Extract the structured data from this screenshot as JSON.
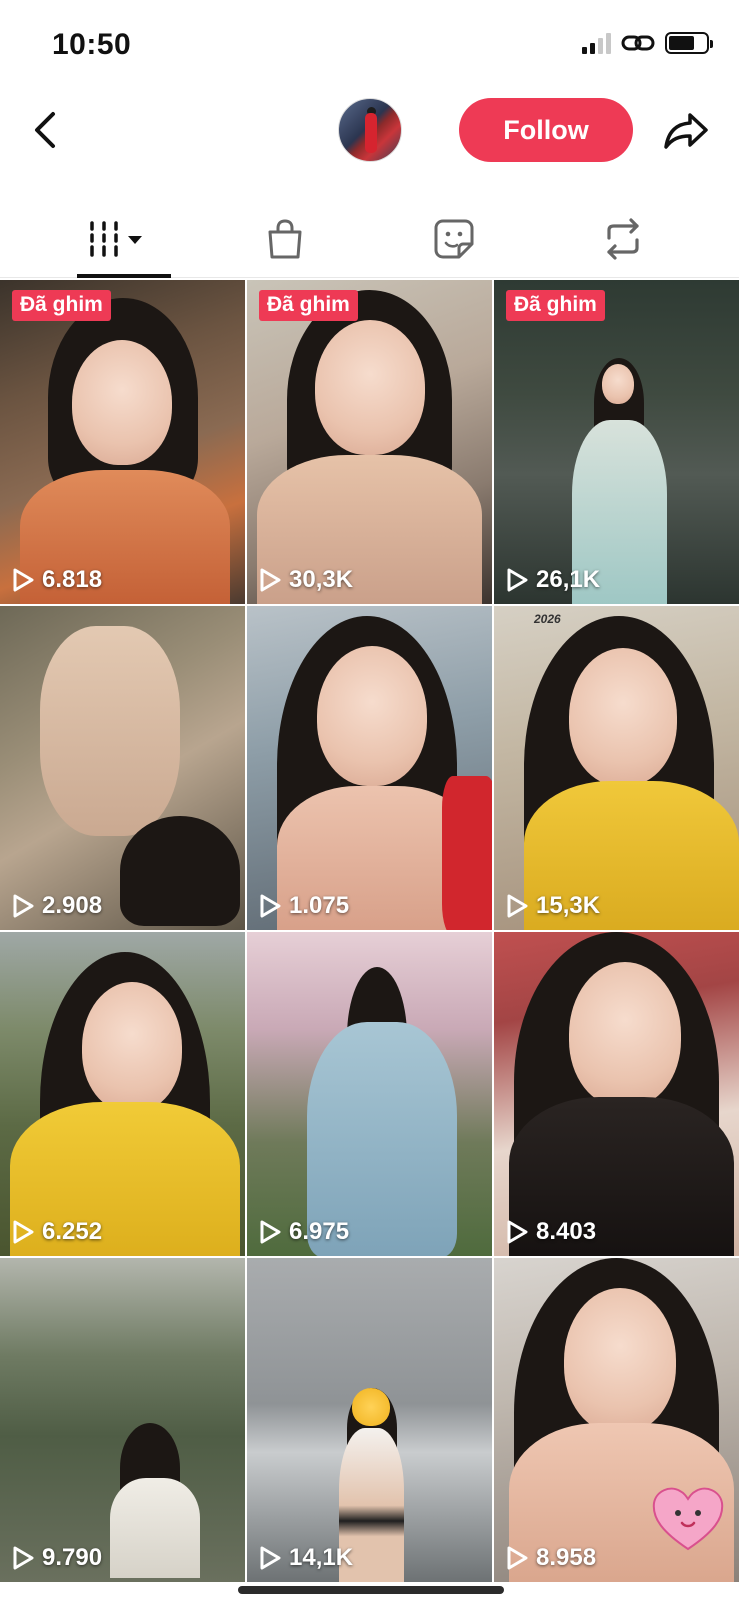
{
  "status_bar": {
    "time": "10:50"
  },
  "header": {
    "follow_label": "Follow",
    "icons": [
      "chevron-left-icon",
      "share-icon"
    ],
    "colors": {
      "follow_bg": "#ee3a55",
      "follow_text": "#ffffff"
    }
  },
  "tabs": [
    {
      "icon": "videos-grid-icon",
      "active": true
    },
    {
      "icon": "shopping-bag-icon",
      "active": false
    },
    {
      "icon": "sticker-icon",
      "active": false
    },
    {
      "icon": "repost-icon",
      "active": false
    }
  ],
  "videos": [
    {
      "pinned_label": "Đã ghim",
      "views": "6.818"
    },
    {
      "pinned_label": "Đã ghim",
      "views": "30,3K"
    },
    {
      "pinned_label": "Đã ghim",
      "views": "26,1K"
    },
    {
      "views": "2.908"
    },
    {
      "views": "1.075"
    },
    {
      "views": "15,3K",
      "overlay_text": "2026"
    },
    {
      "views": "6.252"
    },
    {
      "views": "6.975"
    },
    {
      "views": "8.403"
    },
    {
      "views": "9.790"
    },
    {
      "views": "14,1K"
    },
    {
      "views": "8.958"
    }
  ],
  "accent_color": "#ee3a55"
}
